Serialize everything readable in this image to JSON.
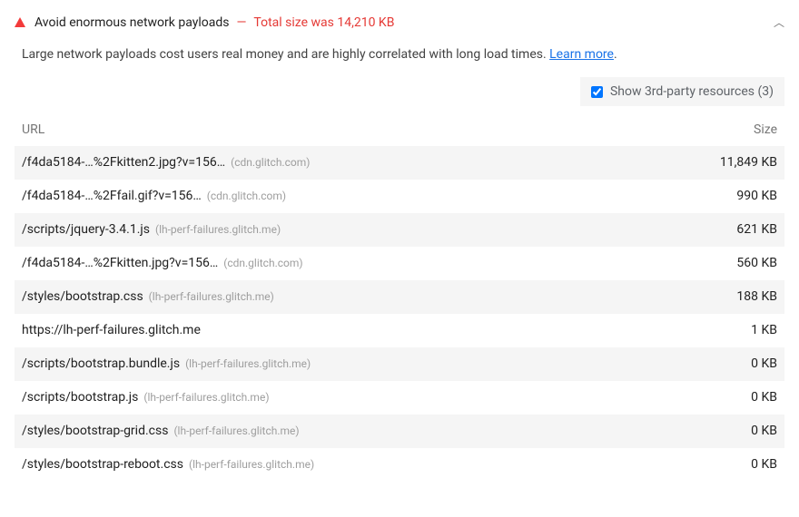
{
  "header": {
    "title": "Avoid enormous network payloads",
    "separator": "—",
    "detail": "Total size was 14,210 KB"
  },
  "description": {
    "text": "Large network payloads cost users real money and are highly correlated with long load times. ",
    "learn_more": "Learn more",
    "period": "."
  },
  "thirdparty": {
    "label": "Show 3rd-party resources (3)"
  },
  "table": {
    "columns": {
      "url": "URL",
      "size": "Size"
    },
    "rows": [
      {
        "path": "/f4da5184-…%2Fkitten2.jpg?v=156…",
        "origin": "(cdn.glitch.com)",
        "size": "11,849 KB"
      },
      {
        "path": "/f4da5184-…%2Ffail.gif?v=156…",
        "origin": "(cdn.glitch.com)",
        "size": "990 KB"
      },
      {
        "path": "/scripts/jquery-3.4.1.js",
        "origin": "(lh-perf-failures.glitch.me)",
        "size": "621 KB"
      },
      {
        "path": "/f4da5184-…%2Fkitten.jpg?v=156…",
        "origin": "(cdn.glitch.com)",
        "size": "560 KB"
      },
      {
        "path": "/styles/bootstrap.css",
        "origin": "(lh-perf-failures.glitch.me)",
        "size": "188 KB"
      },
      {
        "path": "https://lh-perf-failures.glitch.me",
        "origin": "",
        "size": "1 KB"
      },
      {
        "path": "/scripts/bootstrap.bundle.js",
        "origin": "(lh-perf-failures.glitch.me)",
        "size": "0 KB"
      },
      {
        "path": "/scripts/bootstrap.js",
        "origin": "(lh-perf-failures.glitch.me)",
        "size": "0 KB"
      },
      {
        "path": "/styles/bootstrap-grid.css",
        "origin": "(lh-perf-failures.glitch.me)",
        "size": "0 KB"
      },
      {
        "path": "/styles/bootstrap-reboot.css",
        "origin": "(lh-perf-failures.glitch.me)",
        "size": "0 KB"
      }
    ]
  }
}
